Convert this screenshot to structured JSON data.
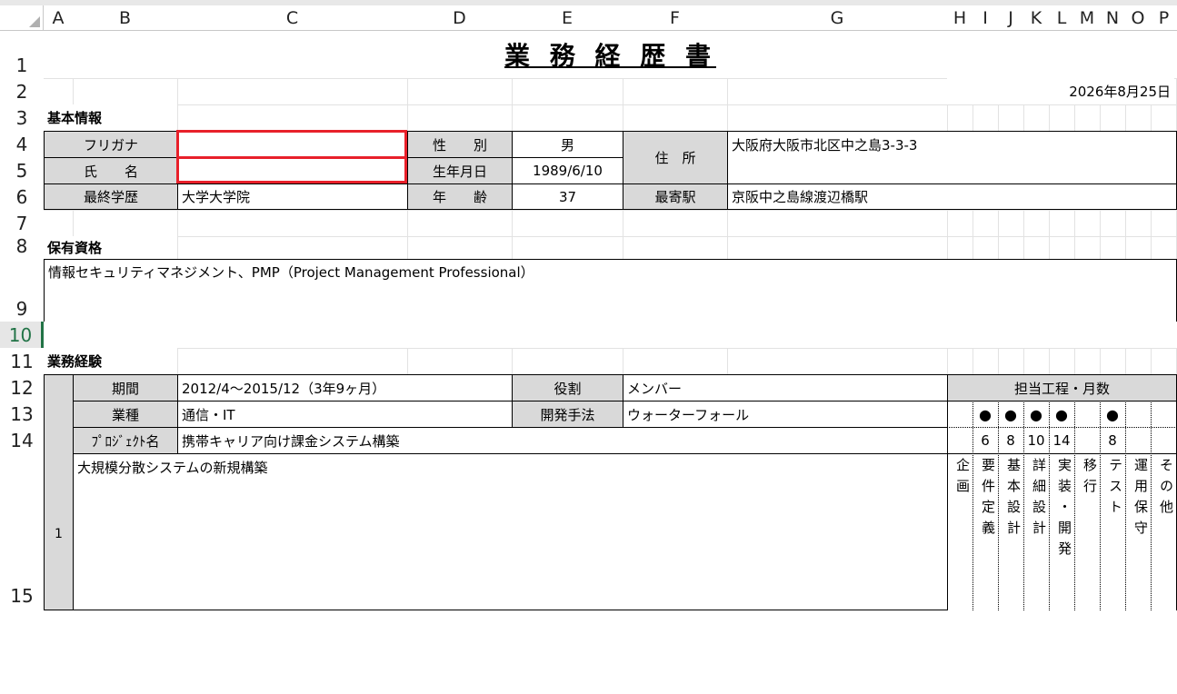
{
  "columns": [
    "A",
    "B",
    "C",
    "D",
    "E",
    "F",
    "G",
    "H",
    "I",
    "J",
    "K",
    "L",
    "M",
    "N",
    "O",
    "P"
  ],
  "rows": [
    "1",
    "2",
    "3",
    "4",
    "5",
    "6",
    "7",
    "8",
    "9",
    "10",
    "11",
    "12",
    "13",
    "14",
    "15"
  ],
  "title": "業 務 経 歴 書",
  "date": "2026年8月25日",
  "sections": {
    "basic": "基本情報",
    "qualifications": "保有資格",
    "experience": "業務経験"
  },
  "basic": {
    "furigana_label": "フリガナ",
    "furigana_value": "",
    "name_label": "氏　　名",
    "name_value": "",
    "education_label": "最終学歴",
    "education_value": "大学大学院",
    "gender_label": "性　　別",
    "gender_value": "男",
    "birth_label": "生年月日",
    "birth_value": "1989/6/10",
    "age_label": "年　　齢",
    "age_value": "37",
    "address_label": "住　所",
    "address_value": "大阪府大阪市北区中之島3-3-3",
    "station_label": "最寄駅",
    "station_value": "京阪中之島線渡辺橋駅"
  },
  "qualifications_text": "情報セキュリティマネジメント、PMP（Project Management Professional）",
  "project": {
    "number": "1",
    "period_label": "期間",
    "period_value": "2012/4～2015/12（3年9ヶ月）",
    "role_label": "役割",
    "role_value": "メンバー",
    "industry_label": "業種",
    "industry_value": "通信・IT",
    "method_label": "開発手法",
    "method_value": "ウォーターフォール",
    "project_label": "ﾌﾟﾛｼﾞｪｸﾄ名",
    "project_value": "携帯キャリア向け課金システム構築",
    "description": "大規模分散システムの新規構築",
    "process_header": "担当工程・月数",
    "processes": [
      {
        "name": "企画",
        "dot": "",
        "months": ""
      },
      {
        "name": "要件定義",
        "dot": "●",
        "months": "6"
      },
      {
        "name": "基本設計",
        "dot": "●",
        "months": "8"
      },
      {
        "name": "詳細設計",
        "dot": "●",
        "months": "10"
      },
      {
        "name": "実装・開発",
        "dot": "●",
        "months": "14"
      },
      {
        "name": "移行",
        "dot": "",
        "months": ""
      },
      {
        "name": "テスト",
        "dot": "●",
        "months": "8"
      },
      {
        "name": "運用保守",
        "dot": "",
        "months": ""
      },
      {
        "name": "その他",
        "dot": "",
        "months": ""
      }
    ]
  }
}
